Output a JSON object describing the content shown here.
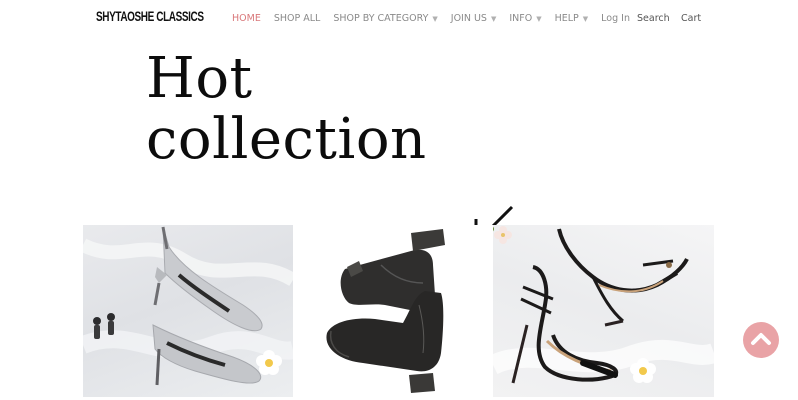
{
  "header": {
    "logo_text": "SHYTAOSHE CLASSICS",
    "nav": [
      {
        "label": "HOME",
        "active": true,
        "has_dropdown": false
      },
      {
        "label": "SHOP ALL",
        "active": false,
        "has_dropdown": false
      },
      {
        "label": "SHOP BY CATEGORY",
        "active": false,
        "has_dropdown": true
      },
      {
        "label": "JOIN US",
        "active": false,
        "has_dropdown": true
      },
      {
        "label": "INFO",
        "active": false,
        "has_dropdown": true
      },
      {
        "label": "HELP",
        "active": false,
        "has_dropdown": true
      },
      {
        "label": "Log In",
        "active": false,
        "has_dropdown": false
      }
    ],
    "search_label": "Search",
    "cart_label": "Cart"
  },
  "hero": {
    "title_line1": "Hot",
    "title_line2": "collection"
  },
  "gallery": {
    "items": [
      {
        "subject": "silver glitter pumps"
      },
      {
        "subject": "black leather ankle boots"
      },
      {
        "subject": "black strappy heeled sandals"
      }
    ]
  },
  "icons": {
    "hero_arrow": "arrow-down-left-icon",
    "scroll_top": "chevron-up-icon"
  },
  "colors": {
    "nav_active": "#d9787a",
    "nav_default": "#8a8a8a",
    "scroll_button": "#e9a3a6"
  }
}
